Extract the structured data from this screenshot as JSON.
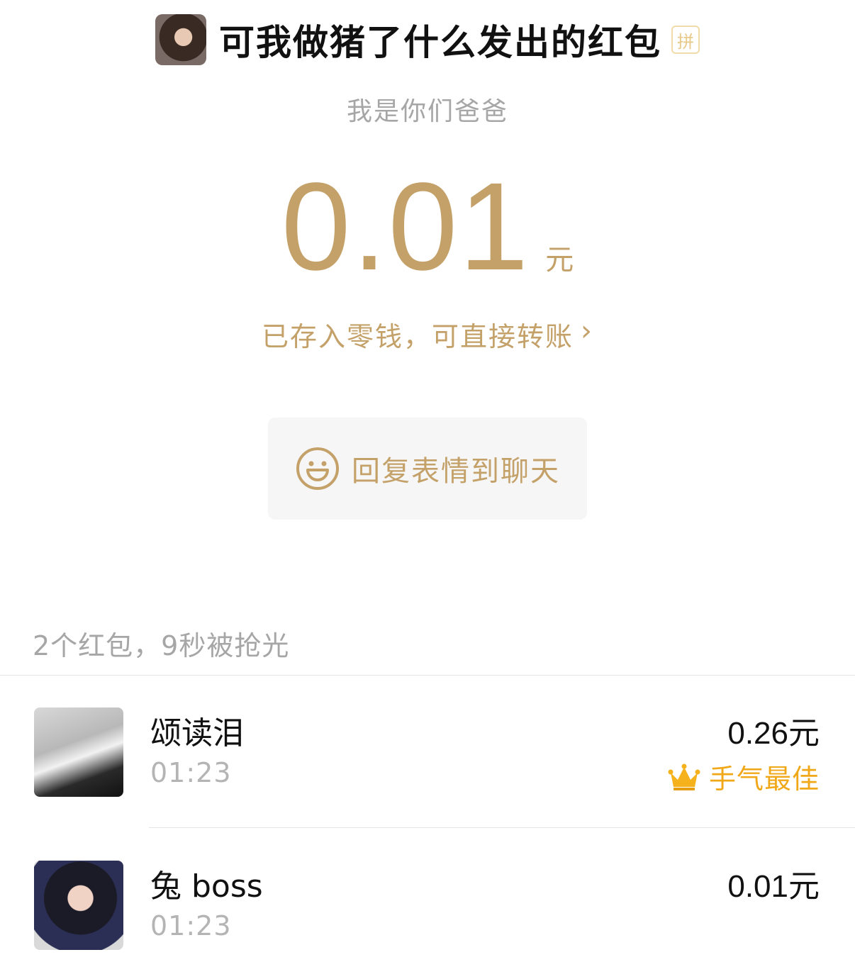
{
  "header": {
    "title": "可我做猪了什么发出的红包",
    "badge": "拼"
  },
  "blessing": "我是你们爸爸",
  "amount": {
    "value": "0.01",
    "unit": "元"
  },
  "stored_note": "已存入零钱，可直接转账",
  "stored_chevron": "›",
  "reply_button": {
    "label": "回复表情到聊天"
  },
  "summary": "2个红包，9秒被抢光",
  "recipients": [
    {
      "name": "颂读泪",
      "time": "01:23",
      "amount": "0.26",
      "unit": "元",
      "best_label": "手气最佳"
    },
    {
      "name": "兔 boss",
      "time": "01:23",
      "amount": "0.01",
      "unit": "元"
    }
  ],
  "colors": {
    "gold": "#c4a169",
    "best": "#f0a818",
    "muted": "#a6a6a6"
  }
}
